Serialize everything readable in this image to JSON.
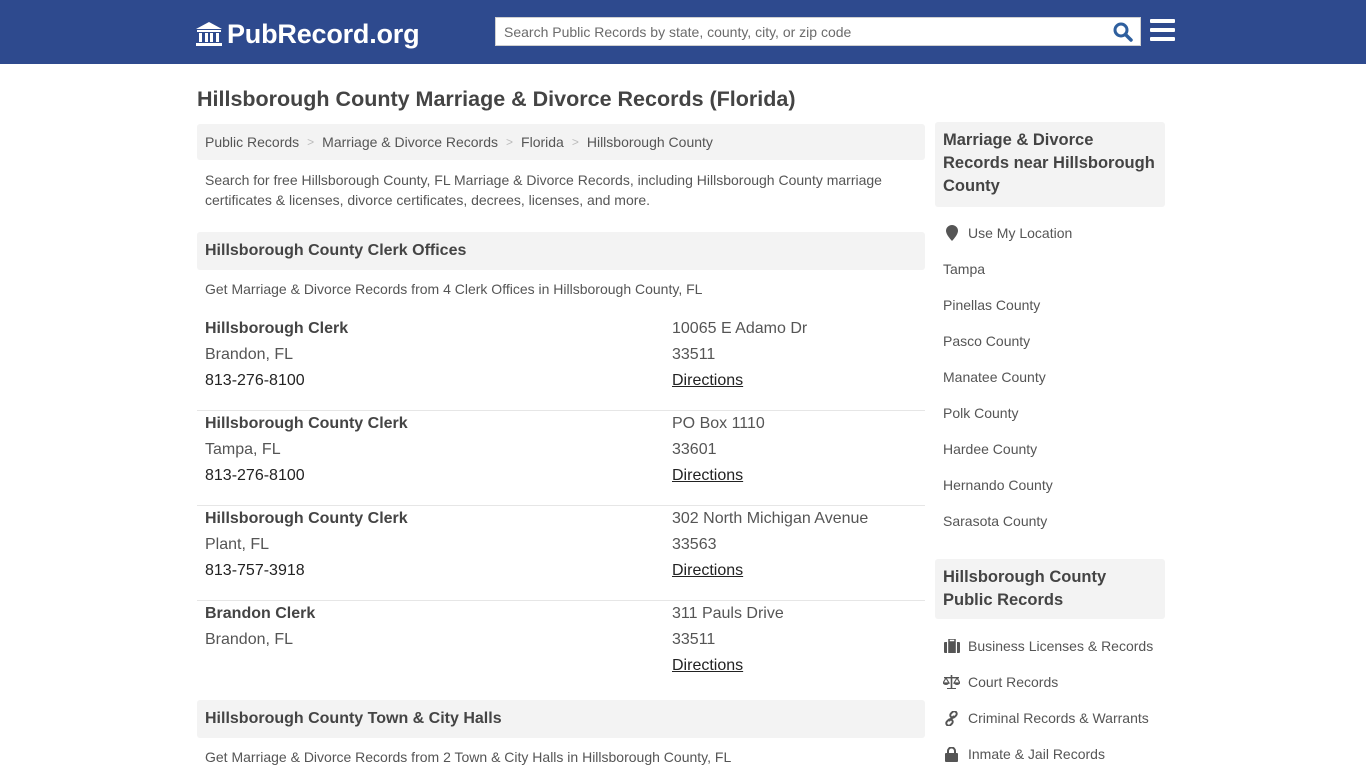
{
  "header": {
    "logo_text": "PubRecord.org",
    "search_placeholder": "Search Public Records by state, county, city, or zip code",
    "brand_color": "#2e4a8e"
  },
  "page_title": "Hillsborough County Marriage & Divorce Records (Florida)",
  "breadcrumb": [
    {
      "label": "Public Records"
    },
    {
      "label": "Marriage & Divorce Records"
    },
    {
      "label": "Florida"
    },
    {
      "label": "Hillsborough County"
    }
  ],
  "intro": "Search for free Hillsborough County, FL Marriage & Divorce Records, including Hillsborough County marriage certificates & licenses, divorce certificates, decrees, licenses, and more.",
  "clerk_section": {
    "title": "Hillsborough County Clerk Offices",
    "subtitle": "Get Marriage & Divorce Records from 4 Clerk Offices in Hillsborough County, FL",
    "offices": [
      {
        "name": "Hillsborough Clerk",
        "city": "Brandon, FL",
        "phone": "813-276-8100",
        "address": "10065 E Adamo Dr",
        "zip": "33511",
        "directions": "Directions"
      },
      {
        "name": "Hillsborough County Clerk",
        "city": "Tampa, FL",
        "phone": "813-276-8100",
        "address": "PO Box 1110",
        "zip": "33601",
        "directions": "Directions"
      },
      {
        "name": "Hillsborough County Clerk",
        "city": "Plant, FL",
        "phone": "813-757-3918",
        "address": "302 North Michigan Avenue",
        "zip": "33563",
        "directions": "Directions"
      },
      {
        "name": "Brandon Clerk",
        "city": "Brandon, FL",
        "phone": "",
        "address": "311 Pauls Drive",
        "zip": "33511",
        "directions": "Directions"
      }
    ]
  },
  "city_hall_section": {
    "title": "Hillsborough County Town & City Halls",
    "subtitle": "Get Marriage & Divorce Records from 2 Town & City Halls in Hillsborough County, FL"
  },
  "sidebar": {
    "nearby": {
      "title": "Marriage & Divorce Records near Hillsborough County",
      "use_location": "Use My Location",
      "items": [
        "Tampa",
        "Pinellas County",
        "Pasco County",
        "Manatee County",
        "Polk County",
        "Hardee County",
        "Hernando County",
        "Sarasota County"
      ]
    },
    "public_records": {
      "title": "Hillsborough County Public Records",
      "items": [
        {
          "label": "Business Licenses & Records",
          "icon": "briefcase-icon"
        },
        {
          "label": "Court Records",
          "icon": "scale-icon"
        },
        {
          "label": "Criminal Records & Warrants",
          "icon": "link-icon"
        },
        {
          "label": "Inmate & Jail Records",
          "icon": "lock-icon"
        }
      ]
    }
  }
}
